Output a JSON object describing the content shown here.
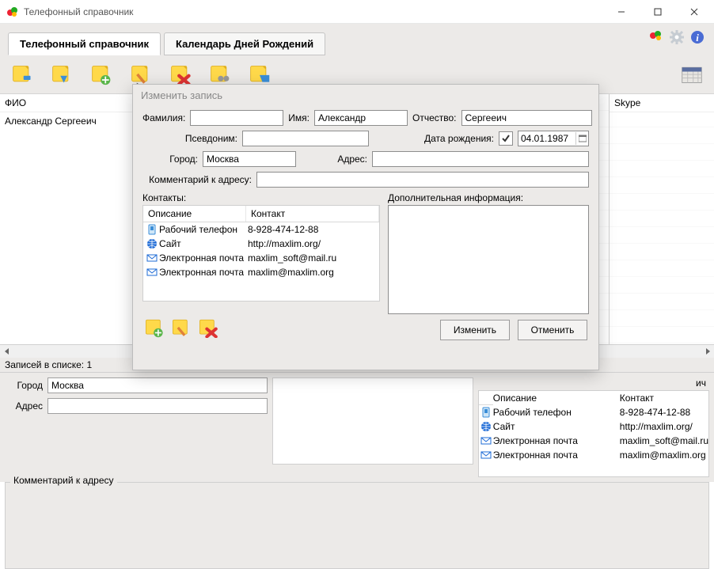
{
  "window": {
    "title": "Телефонный справочник"
  },
  "tabs": {
    "directory": "Телефонный справочник",
    "calendar": "Календарь Дней Рождений"
  },
  "columns": {
    "fio": "ФИО",
    "skype": "Skype"
  },
  "list": {
    "row0": "Александр Сергееич"
  },
  "status": {
    "records": "Записей в списке: 1"
  },
  "bottom": {
    "city_label": "Город",
    "city_value": "Москва",
    "address_label": "Адрес",
    "address_value": "",
    "comment_label": "Комментарий к адресу",
    "contacts_hdr_desc": "Описание",
    "contacts_hdr_cont": "Контакт",
    "contacts": [
      {
        "icon": "phone",
        "desc": "Рабочий телефон",
        "value": "8-928-474-12-88"
      },
      {
        "icon": "web",
        "desc": "Сайт",
        "value": "http://maxlim.org/"
      },
      {
        "icon": "mail",
        "desc": "Электронная почта",
        "value": "maxlim_soft@mail.ru"
      },
      {
        "icon": "mail",
        "desc": "Электронная почта",
        "value": "maxlim@maxlim.org"
      }
    ],
    "trailing": "ич"
  },
  "modal": {
    "title": "Изменить запись",
    "labels": {
      "surname": "Фамилия:",
      "name": "Имя:",
      "patronymic": "Отчество:",
      "alias": "Псевдоним:",
      "dob": "Дата рождения:",
      "city": "Город:",
      "address": "Адрес:",
      "address_comment": "Комментарий к адресу:",
      "contacts": "Контакты:",
      "addinfo": "Дополнительная информация:",
      "col_desc": "Описание",
      "col_cont": "Контакт"
    },
    "values": {
      "surname": "",
      "name": "Александр",
      "patronymic": "Сергееич",
      "alias": "",
      "dob_checked": true,
      "dob": "04.01.1987",
      "city": "Москва",
      "address": "",
      "address_comment": ""
    },
    "contacts": [
      {
        "icon": "phone",
        "desc": "Рабочий телефон",
        "value": "8-928-474-12-88"
      },
      {
        "icon": "web",
        "desc": "Сайт",
        "value": "http://maxlim.org/"
      },
      {
        "icon": "mail",
        "desc": "Электронная почта",
        "value": "maxlim_soft@mail.ru"
      },
      {
        "icon": "mail",
        "desc": "Электронная почта",
        "value": "maxlim@maxlim.org"
      }
    ],
    "buttons": {
      "ok": "Изменить",
      "cancel": "Отменить"
    }
  }
}
